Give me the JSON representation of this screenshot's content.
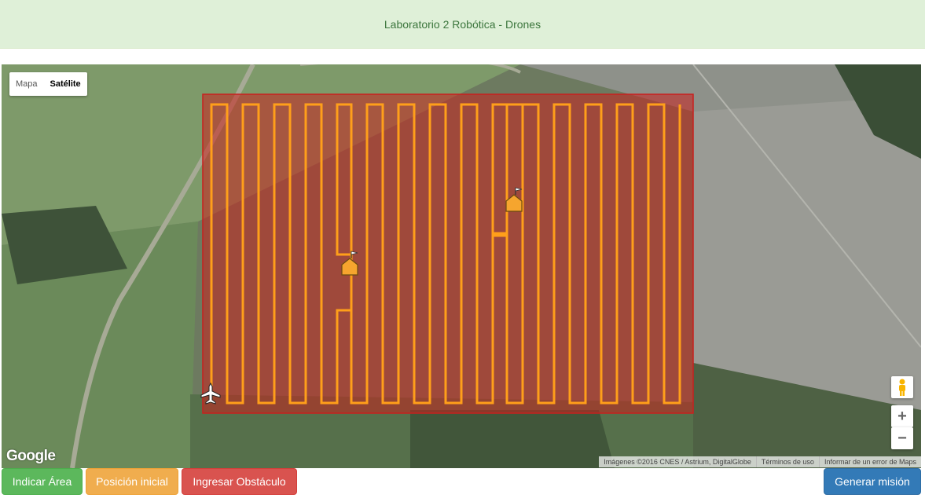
{
  "header": {
    "title": "Laboratorio 2 Robótica - Drones"
  },
  "map": {
    "type_control": {
      "options": [
        "Mapa",
        "Satélite"
      ],
      "selected": "Satélite"
    },
    "zoom_in_label": "+",
    "zoom_out_label": "−",
    "google_logo": "Google",
    "attribution": {
      "imagery": "Imágenes ©2016 CNES / Astrium, DigitalGlobe",
      "terms": "Términos de uso",
      "report": "Informar de un error de Maps"
    },
    "overlays": {
      "area_color": "#c8201e",
      "path_color": "#ff9f1a",
      "obstacle_icon": "flag-house-icon",
      "start_icon": "airplane-icon"
    }
  },
  "actions": {
    "indicate_area": "Indicar Área",
    "start_position": "Posición inicial",
    "add_obstacle": "Ingresar Obstáculo",
    "generate_mission": "Generar misión"
  },
  "colors": {
    "success": "#5cb85c",
    "warning": "#f0ad4e",
    "danger": "#d9534f",
    "primary": "#337ab7"
  }
}
